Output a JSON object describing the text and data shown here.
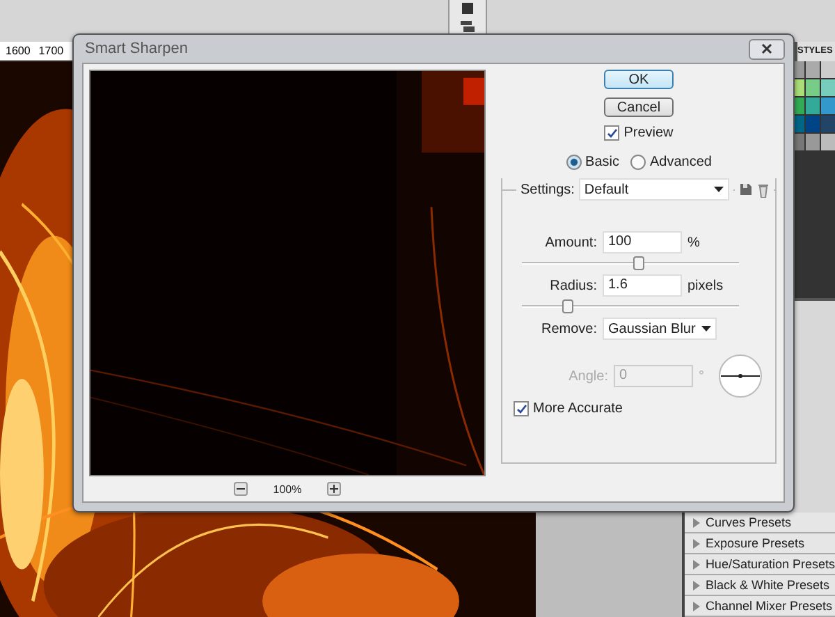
{
  "workspace": {
    "ruler_labels": [
      "1600",
      "1700"
    ],
    "panel_title": "STYLES",
    "presets": [
      {
        "label": "Curves Presets"
      },
      {
        "label": "Exposure Presets"
      },
      {
        "label": "Hue/Saturation Presets"
      },
      {
        "label": "Black & White Presets"
      },
      {
        "label": "Channel Mixer Presets"
      }
    ]
  },
  "dialog": {
    "title": "Smart Sharpen",
    "zoom": "100%",
    "buttons": [
      {
        "label": "OK",
        "default": true
      },
      {
        "label": "Cancel",
        "default": false
      }
    ],
    "preview": {
      "label": "Preview",
      "checked": true
    },
    "modes": [
      {
        "label": "Basic",
        "selected": true
      },
      {
        "label": "Advanced",
        "selected": false
      }
    ],
    "settings": {
      "label": "Settings:",
      "value": "Default"
    },
    "amount": {
      "label": "Amount:",
      "value": "100",
      "unit": "%",
      "level": 0.54
    },
    "radius": {
      "label": "Radius:",
      "value": "1.6",
      "unit": "pixels",
      "level": 0.21
    },
    "remove": {
      "label": "Remove:",
      "value": "Gaussian Blur"
    },
    "angle": {
      "label": "Angle:",
      "value": "0",
      "unit": "°",
      "disabled": true
    },
    "more_accurate": {
      "label": "More Accurate",
      "checked": true
    }
  }
}
